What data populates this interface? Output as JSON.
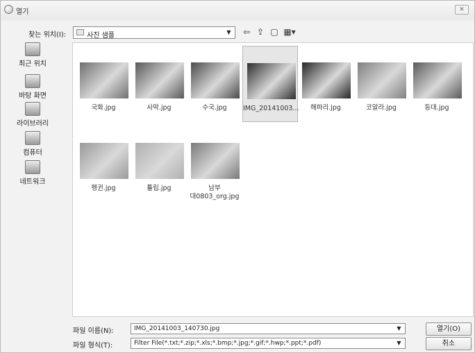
{
  "window": {
    "title": "열기"
  },
  "lookin": {
    "label": "찾는 위치(I):",
    "value": "사진 샘플"
  },
  "places": [
    {
      "label": "최근 위치",
      "icon": "recent-places-icon"
    },
    {
      "label": "바탕 화면",
      "icon": "desktop-icon"
    },
    {
      "label": "라이브러리",
      "icon": "libraries-icon"
    },
    {
      "label": "컴퓨터",
      "icon": "computer-icon"
    },
    {
      "label": "네트워크",
      "icon": "network-icon"
    }
  ],
  "files": [
    {
      "name": "국화.jpg",
      "selected": false,
      "thumb_color": "#6f6f6f"
    },
    {
      "name": "사막.jpg",
      "selected": false,
      "thumb_color": "#595959"
    },
    {
      "name": "수국.jpg",
      "selected": false,
      "thumb_color": "#4a4a4a"
    },
    {
      "name": "IMG_20141003...",
      "selected": true,
      "thumb_color": "#2f2f2f"
    },
    {
      "name": "해파리.jpg",
      "selected": false,
      "thumb_color": "#262626"
    },
    {
      "name": "코알라.jpg",
      "selected": false,
      "thumb_color": "#808080"
    },
    {
      "name": "등대.jpg",
      "selected": false,
      "thumb_color": "#5a5a5a"
    },
    {
      "name": "펭귄.jpg",
      "selected": false,
      "thumb_color": "#9a9a9a"
    },
    {
      "name": "튤립.jpg",
      "selected": false,
      "thumb_color": "#b0b0b0"
    },
    {
      "name": "남부\n대0803_org.jpg",
      "selected": false,
      "thumb_color": "#7a7a7a"
    }
  ],
  "filename": {
    "label": "파일 이름(N):",
    "value": "IMG_20141003_140730.jpg"
  },
  "filetype": {
    "label": "파일 형식(T):",
    "value": "Filter File(*.txt;*.zip;*.xls;*.bmp;*.jpg;*.gif;*.hwp;*.ppt;*.pdf)"
  },
  "buttons": {
    "open": "열기(O)",
    "cancel": "취소"
  }
}
